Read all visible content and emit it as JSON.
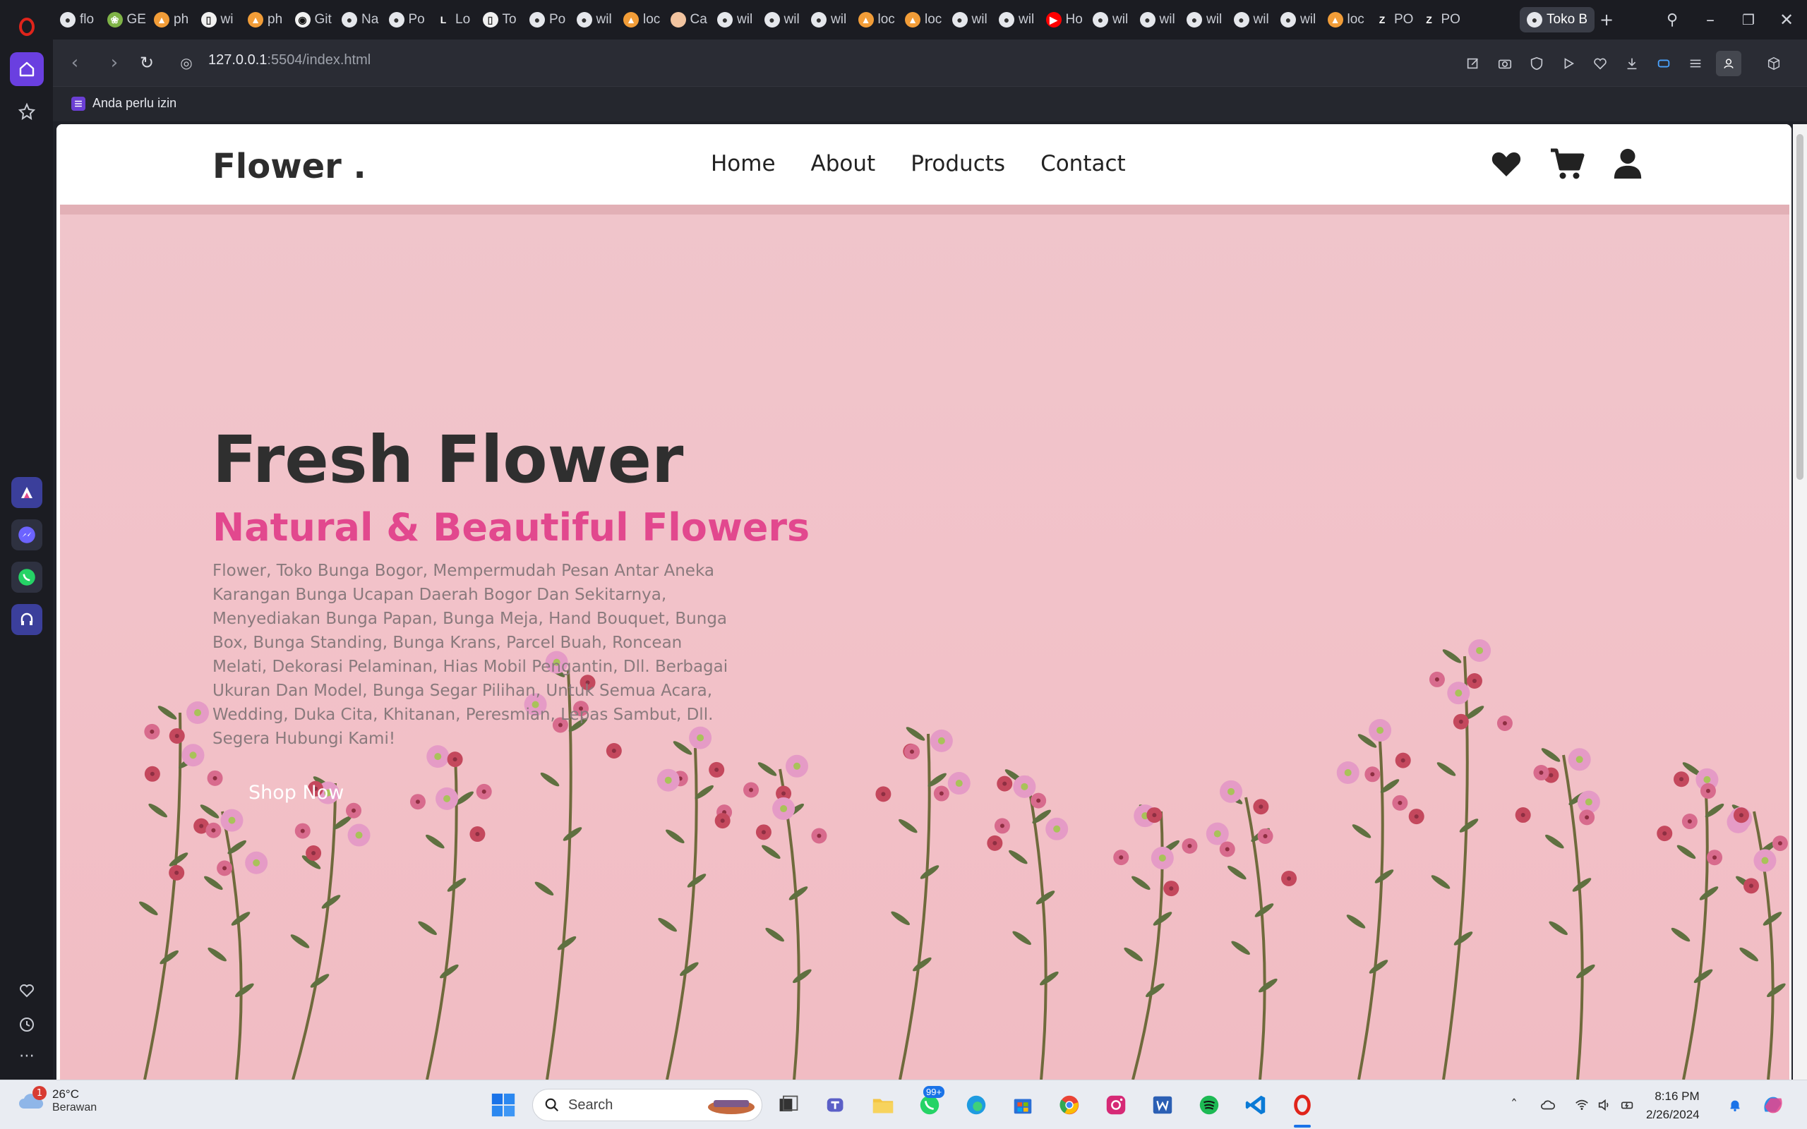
{
  "browser": {
    "tabs": [
      {
        "label": "flo",
        "favicon": "globe-icon"
      },
      {
        "label": "GE",
        "favicon": "fruit-icon"
      },
      {
        "label": "ph",
        "favicon": "sailboat-icon"
      },
      {
        "label": "wi",
        "favicon": "document-icon"
      },
      {
        "label": "ph",
        "favicon": "sailboat-icon"
      },
      {
        "label": "Git",
        "favicon": "github-icon"
      },
      {
        "label": "Na",
        "favicon": "globe-icon"
      },
      {
        "label": "Po",
        "favicon": "globe-icon"
      },
      {
        "label": "Lo",
        "favicon": "letter-l-icon"
      },
      {
        "label": "To",
        "favicon": "document-icon"
      },
      {
        "label": "Po",
        "favicon": "globe-icon"
      },
      {
        "label": "wil",
        "favicon": "globe-icon"
      },
      {
        "label": "loc",
        "favicon": "sailboat-icon"
      },
      {
        "label": "Ca",
        "favicon": "gradient-icon"
      },
      {
        "label": "wil",
        "favicon": "globe-icon"
      },
      {
        "label": "wil",
        "favicon": "globe-icon"
      },
      {
        "label": "wil",
        "favicon": "globe-icon"
      },
      {
        "label": "loc",
        "favicon": "sailboat-icon"
      },
      {
        "label": "loc",
        "favicon": "sailboat-icon"
      },
      {
        "label": "wil",
        "favicon": "globe-icon"
      },
      {
        "label": "wil",
        "favicon": "globe-icon"
      },
      {
        "label": "Ho",
        "favicon": "youtube-icon"
      },
      {
        "label": "wil",
        "favicon": "globe-icon"
      },
      {
        "label": "wil",
        "favicon": "globe-icon"
      },
      {
        "label": "wil",
        "favicon": "globe-icon"
      },
      {
        "label": "wil",
        "favicon": "globe-icon"
      },
      {
        "label": "wil",
        "favicon": "globe-icon"
      },
      {
        "label": "loc",
        "favicon": "sailboat-icon"
      },
      {
        "label": "PO",
        "favicon": "zap-icon"
      },
      {
        "label": "PO",
        "favicon": "zap-icon"
      }
    ],
    "active_tab": {
      "label": "Toko B",
      "favicon": "globe-icon"
    },
    "url_host": "127.0.0.1",
    "url_rest": ":5504/index.html",
    "bookmark": "Anda perlu izin"
  },
  "site": {
    "logo": "Flower .",
    "nav": [
      "Home",
      "About",
      "Products",
      "Contact"
    ],
    "hero": {
      "title": "Fresh Flower",
      "subtitle": "Natural & Beautiful Flowers",
      "description": "Flower, Toko Bunga Bogor, Mempermudah Pesan Antar Aneka Karangan Bunga Ucapan Daerah Bogor Dan Sekitarnya, Menyediakan Bunga Papan, Bunga Meja, Hand Bouquet, Bunga Box, Bunga Standing, Bunga Krans, Parcel Buah, Roncean Melati, Dekorasi Pelaminan, Hias Mobil Pengantin, Dll. Berbagai Ukuran Dan Model, Bunga Segar Pilihan, Untuk Semua Acara, Wedding, Duka Cita, Khitanan, Peresmian, Lepas Sambut, Dll. Segera Hubungi Kami!",
      "cta": "Shop Now"
    },
    "colors": {
      "accent_pink": "#e2488e",
      "hero_bg": "#f1c1c8",
      "text_dark": "#2d2d2d"
    }
  },
  "taskbar": {
    "weather_temp": "26°C",
    "weather_cond": "Berawan",
    "weather_badge": "1",
    "search_placeholder": "Search",
    "whatsapp_badge": "99+",
    "time": "8:16 PM",
    "date": "2/26/2024"
  }
}
